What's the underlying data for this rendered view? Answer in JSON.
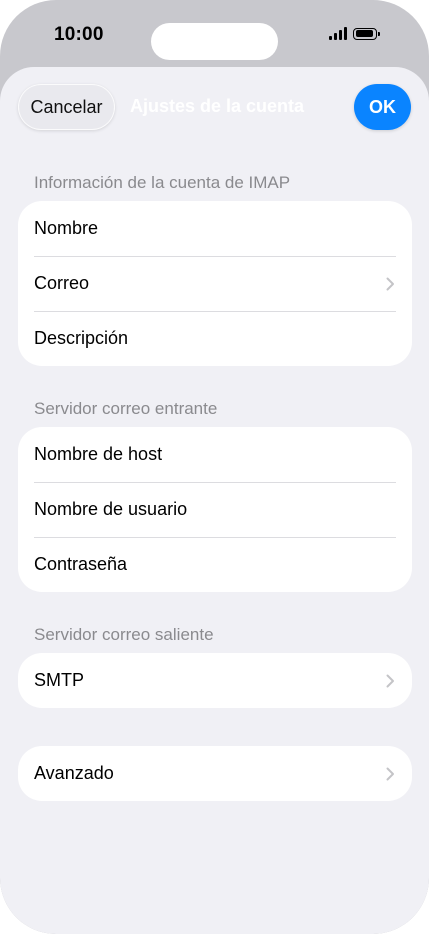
{
  "status_bar": {
    "time": "10:00"
  },
  "nav": {
    "cancel_label": "Cancelar",
    "title": "Ajustes de la cuenta",
    "ok_label": "OK"
  },
  "sections": {
    "account_info": {
      "header": "Información de la cuenta de IMAP",
      "rows": [
        "Nombre",
        "Correo",
        "Descripción"
      ]
    },
    "incoming": {
      "header": "Servidor correo entrante",
      "rows": [
        "Nombre de host",
        "Nombre de usuario",
        "Contraseña"
      ]
    },
    "outgoing": {
      "header": "Servidor correo saliente",
      "rows": [
        "SMTP"
      ]
    },
    "advanced": {
      "rows": [
        "Avanzado"
      ]
    }
  },
  "colors": {
    "accent": "#0a84ff",
    "background": "#f0f0f5",
    "secondary_text": "#8a8a8e"
  },
  "icons": {
    "row_disclosure": "chevron-right-icon",
    "signal": "cellular-signal-icon",
    "battery": "battery-icon"
  }
}
